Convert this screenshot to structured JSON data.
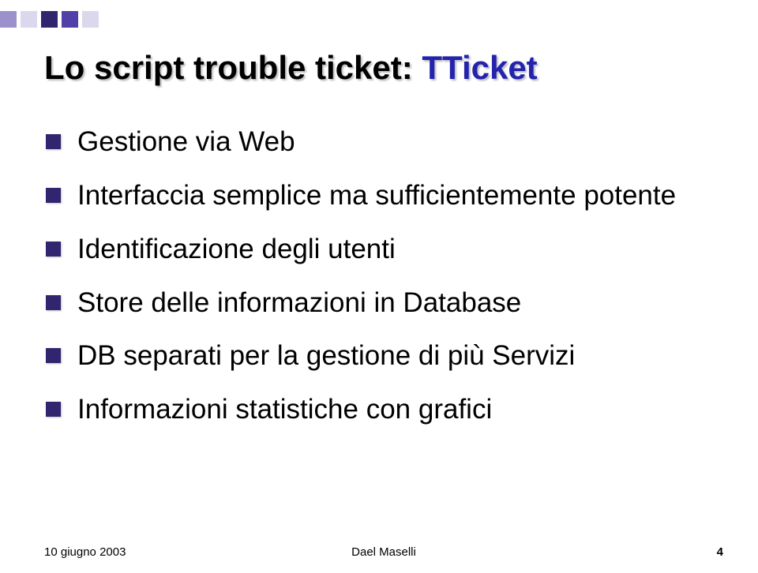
{
  "title": {
    "prefix": "Lo script trouble ticket:  ",
    "highlight": "TTicket"
  },
  "bullets": [
    "Gestione via Web",
    "Interfaccia semplice ma sufficientemente potente",
    "Identificazione degli utenti",
    "Store delle informazioni in Database",
    "DB separati per la gestione di più Servizi",
    "Informazioni statistiche con grafici"
  ],
  "footer": {
    "date": "10 giugno 2003",
    "author": "Dael Maselli",
    "page": "4"
  }
}
